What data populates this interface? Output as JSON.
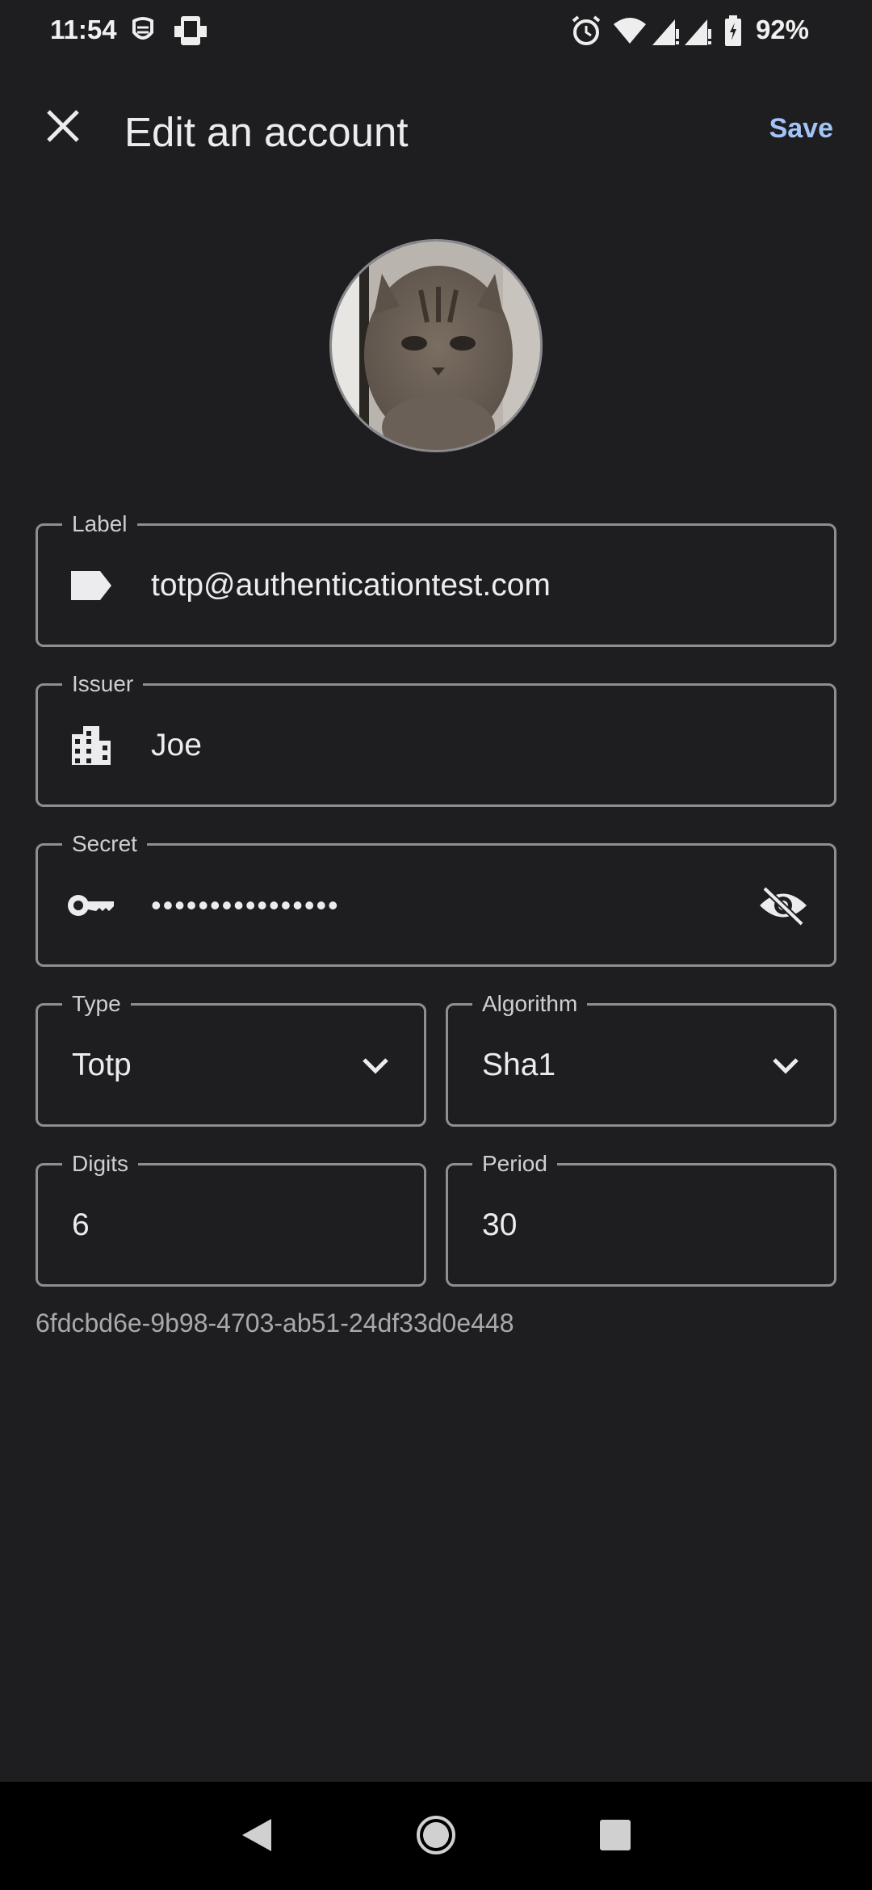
{
  "status_bar": {
    "time": "11:54",
    "battery": "92%",
    "icons": [
      "mask-notification-icon",
      "phone-notification-icon",
      "alarm-icon",
      "wifi-icon",
      "signal-icon",
      "signal-icon-2",
      "battery-charging-icon"
    ]
  },
  "app_bar": {
    "title": "Edit an account",
    "save_label": "Save",
    "close_icon": "close-icon"
  },
  "fields": {
    "label": {
      "label": "Label",
      "value": "totp@authenticationtest.com",
      "icon": "label-tag-icon"
    },
    "issuer": {
      "label": "Issuer",
      "value": "Joe",
      "icon": "building-icon"
    },
    "secret": {
      "label": "Secret",
      "value": "••••••••••••••••",
      "icon": "key-icon",
      "toggle_icon": "visibility-off-icon"
    },
    "type": {
      "label": "Type",
      "value": "Totp"
    },
    "algorithm": {
      "label": "Algorithm",
      "value": "Sha1"
    },
    "digits": {
      "label": "Digits",
      "value": "6"
    },
    "period": {
      "label": "Period",
      "value": "30"
    }
  },
  "uuid": "6fdcbd6e-9b98-4703-ab51-24df33d0e448",
  "colors": {
    "background": "#1e1e20",
    "accent": "#a3c4f7",
    "outline": "#8e8e93"
  }
}
